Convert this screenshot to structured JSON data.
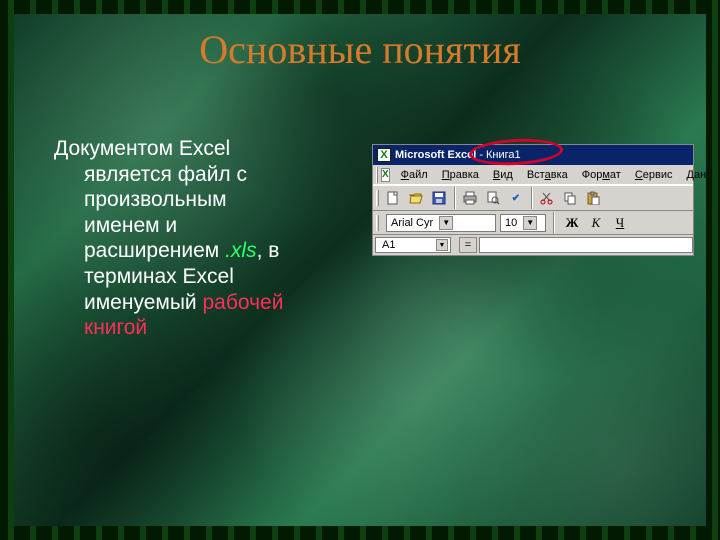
{
  "title": "Основные понятия",
  "body": {
    "line1": "Документом Excel",
    "line2": "является файл с",
    "line3": "произвольным",
    "line4": "именем и",
    "line5a": "расширением ",
    "ext": ".xls",
    "line5b": ", в",
    "line6": "терминах Excel",
    "line7a": "именуемый ",
    "term1": "рабочей",
    "term2": "книгой"
  },
  "excel": {
    "app_name": "Microsoft Excel",
    "doc_name": "Книга1",
    "menu": {
      "file": "Файл",
      "edit": "Правка",
      "view": "Вид",
      "insert": "Вставка",
      "format": "Формат",
      "tools": "Сервис",
      "data": "Дан"
    },
    "toolbar": {
      "new": "new-doc-icon",
      "open": "open-icon",
      "save": "save-icon",
      "print": "print-icon",
      "preview": "preview-icon",
      "spell": "spell-icon",
      "cut": "cut-icon",
      "copy": "copy-icon",
      "paste": "paste-icon"
    },
    "font_name": "Arial Cyr",
    "font_size": "10",
    "bold": "Ж",
    "italic": "К",
    "underline": "Ч",
    "cell_ref": "A1",
    "eq": "="
  }
}
